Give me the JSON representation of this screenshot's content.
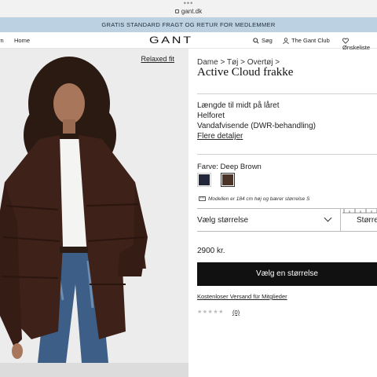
{
  "browser": {
    "dots": "•••",
    "url": "gant.dk"
  },
  "promo": {
    "text": "GRATIS STANDARD FRAGT OG RETUR FOR MEDLEMMER"
  },
  "nav": {
    "left_items": [
      "rn",
      "Home"
    ],
    "logo": "GANT",
    "right_items": [
      {
        "label": "Søg",
        "icon": "search-icon"
      },
      {
        "label": "The Gant Club",
        "icon": "user-icon"
      },
      {
        "label": "Ønskeliste",
        "icon": "heart-icon"
      }
    ]
  },
  "image": {
    "fit_label": "Relaxed fit",
    "colors": {
      "background": "#ececec",
      "jacket": "#3e2219",
      "jeans": "#3d5f87"
    }
  },
  "product": {
    "breadcrumb": "Dame > Tøj > Overtøj >",
    "title": "Active Cloud frakke",
    "features": [
      "Længde til midt på låret",
      "Helforet",
      "Vandafvisende (DWR-behandling)"
    ],
    "more_details": "Flere detaljer",
    "color_label": "Farve: Deep Brown",
    "swatches": [
      {
        "name": "navy",
        "color": "#23273a"
      },
      {
        "name": "deep-brown",
        "color": "#4b3328"
      }
    ],
    "model_info": "Modellen er 184 cm høj og bærer størrelse S",
    "size_select": "Vælg størrelse",
    "size_guide": "Større",
    "price": "2900 kr.",
    "cta": "Vælg en størrelse",
    "shipping_link": "Kostenloser Versand für Mitglieder",
    "rating_stars": "★★★★★",
    "review_count": "(0)"
  }
}
